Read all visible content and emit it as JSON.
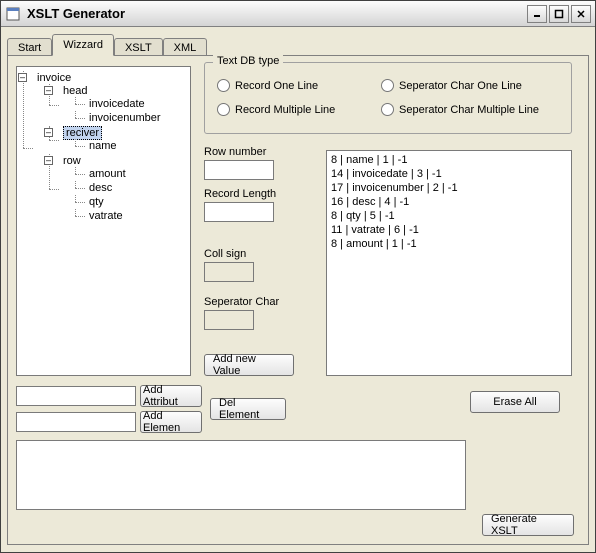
{
  "window": {
    "title": "XSLT Generator"
  },
  "tabs": {
    "t0": "Start",
    "t1": "Wizzard",
    "t2": "XSLT",
    "t3": "XML"
  },
  "tree": {
    "root": "invoice",
    "head": "head",
    "invoicedate": "invoicedate",
    "invoicenumber": "invoicenumber",
    "reciver": "reciver",
    "name": "name",
    "row": "row",
    "amount": "amount",
    "desc": "desc",
    "qty": "qty",
    "vatrate": "vatrate"
  },
  "group": {
    "legend": "Text DB type",
    "r1": "Record One Line",
    "r2": "Seperator Char One Line",
    "r3": "Record Multiple Line",
    "r4": "Seperator Char Multiple Line"
  },
  "labels": {
    "rownum": "Row number",
    "reclen": "Record Length",
    "collsign": "Coll sign",
    "sepchar": "Seperator Char"
  },
  "buttons": {
    "addvalue": "Add new Value",
    "addattr": "Add Attribut",
    "addelem": "Add Elemen",
    "delelem": "Del Element",
    "eraseall": "Erase All",
    "generate": "Generate XSLT"
  },
  "listbox": {
    "l0": "8 | name | 1 | -1",
    "l1": "14 | invoicedate | 3 | -1",
    "l2": "17 | invoicenumber | 2 | -1",
    "l3": "16 | desc | 4 | -1",
    "l4": "8 | qty | 5 | -1",
    "l5": "11 | vatrate | 6 | -1",
    "l6": "8 | amount | 1 | -1"
  },
  "inputs": {
    "rownum": "",
    "reclen": "",
    "collsign": "",
    "sepchar": "",
    "attrname": "",
    "elemname": "",
    "output": ""
  }
}
